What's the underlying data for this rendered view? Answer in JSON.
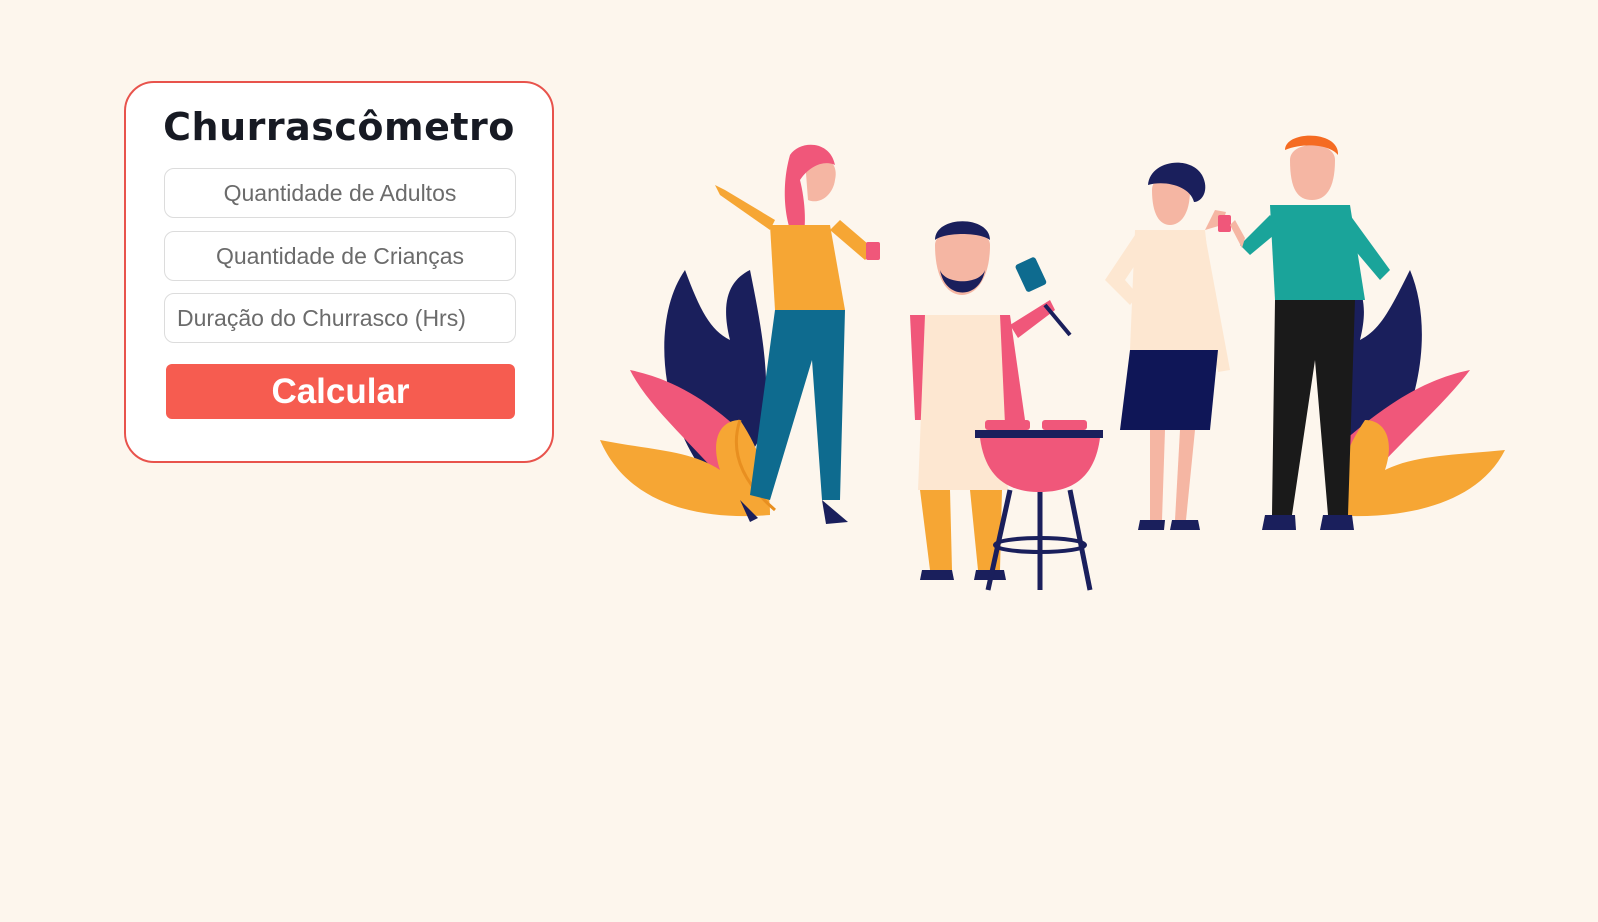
{
  "app": {
    "title": "Churrascômetro"
  },
  "form": {
    "adults_placeholder": "Quantidade de Adultos",
    "adults_value": "",
    "children_placeholder": "Quantidade de Crianças",
    "children_value": "",
    "duration_placeholder": "Duração do Churrasco (Hrs)",
    "duration_value": "",
    "calculate_label": "Calcular"
  },
  "colors": {
    "background": "#fdf6ed",
    "accent": "#f65c50",
    "card_border": "#e8534c",
    "title": "#171a23"
  },
  "illustration": {
    "subject": "barbecue-party-people-icon"
  }
}
